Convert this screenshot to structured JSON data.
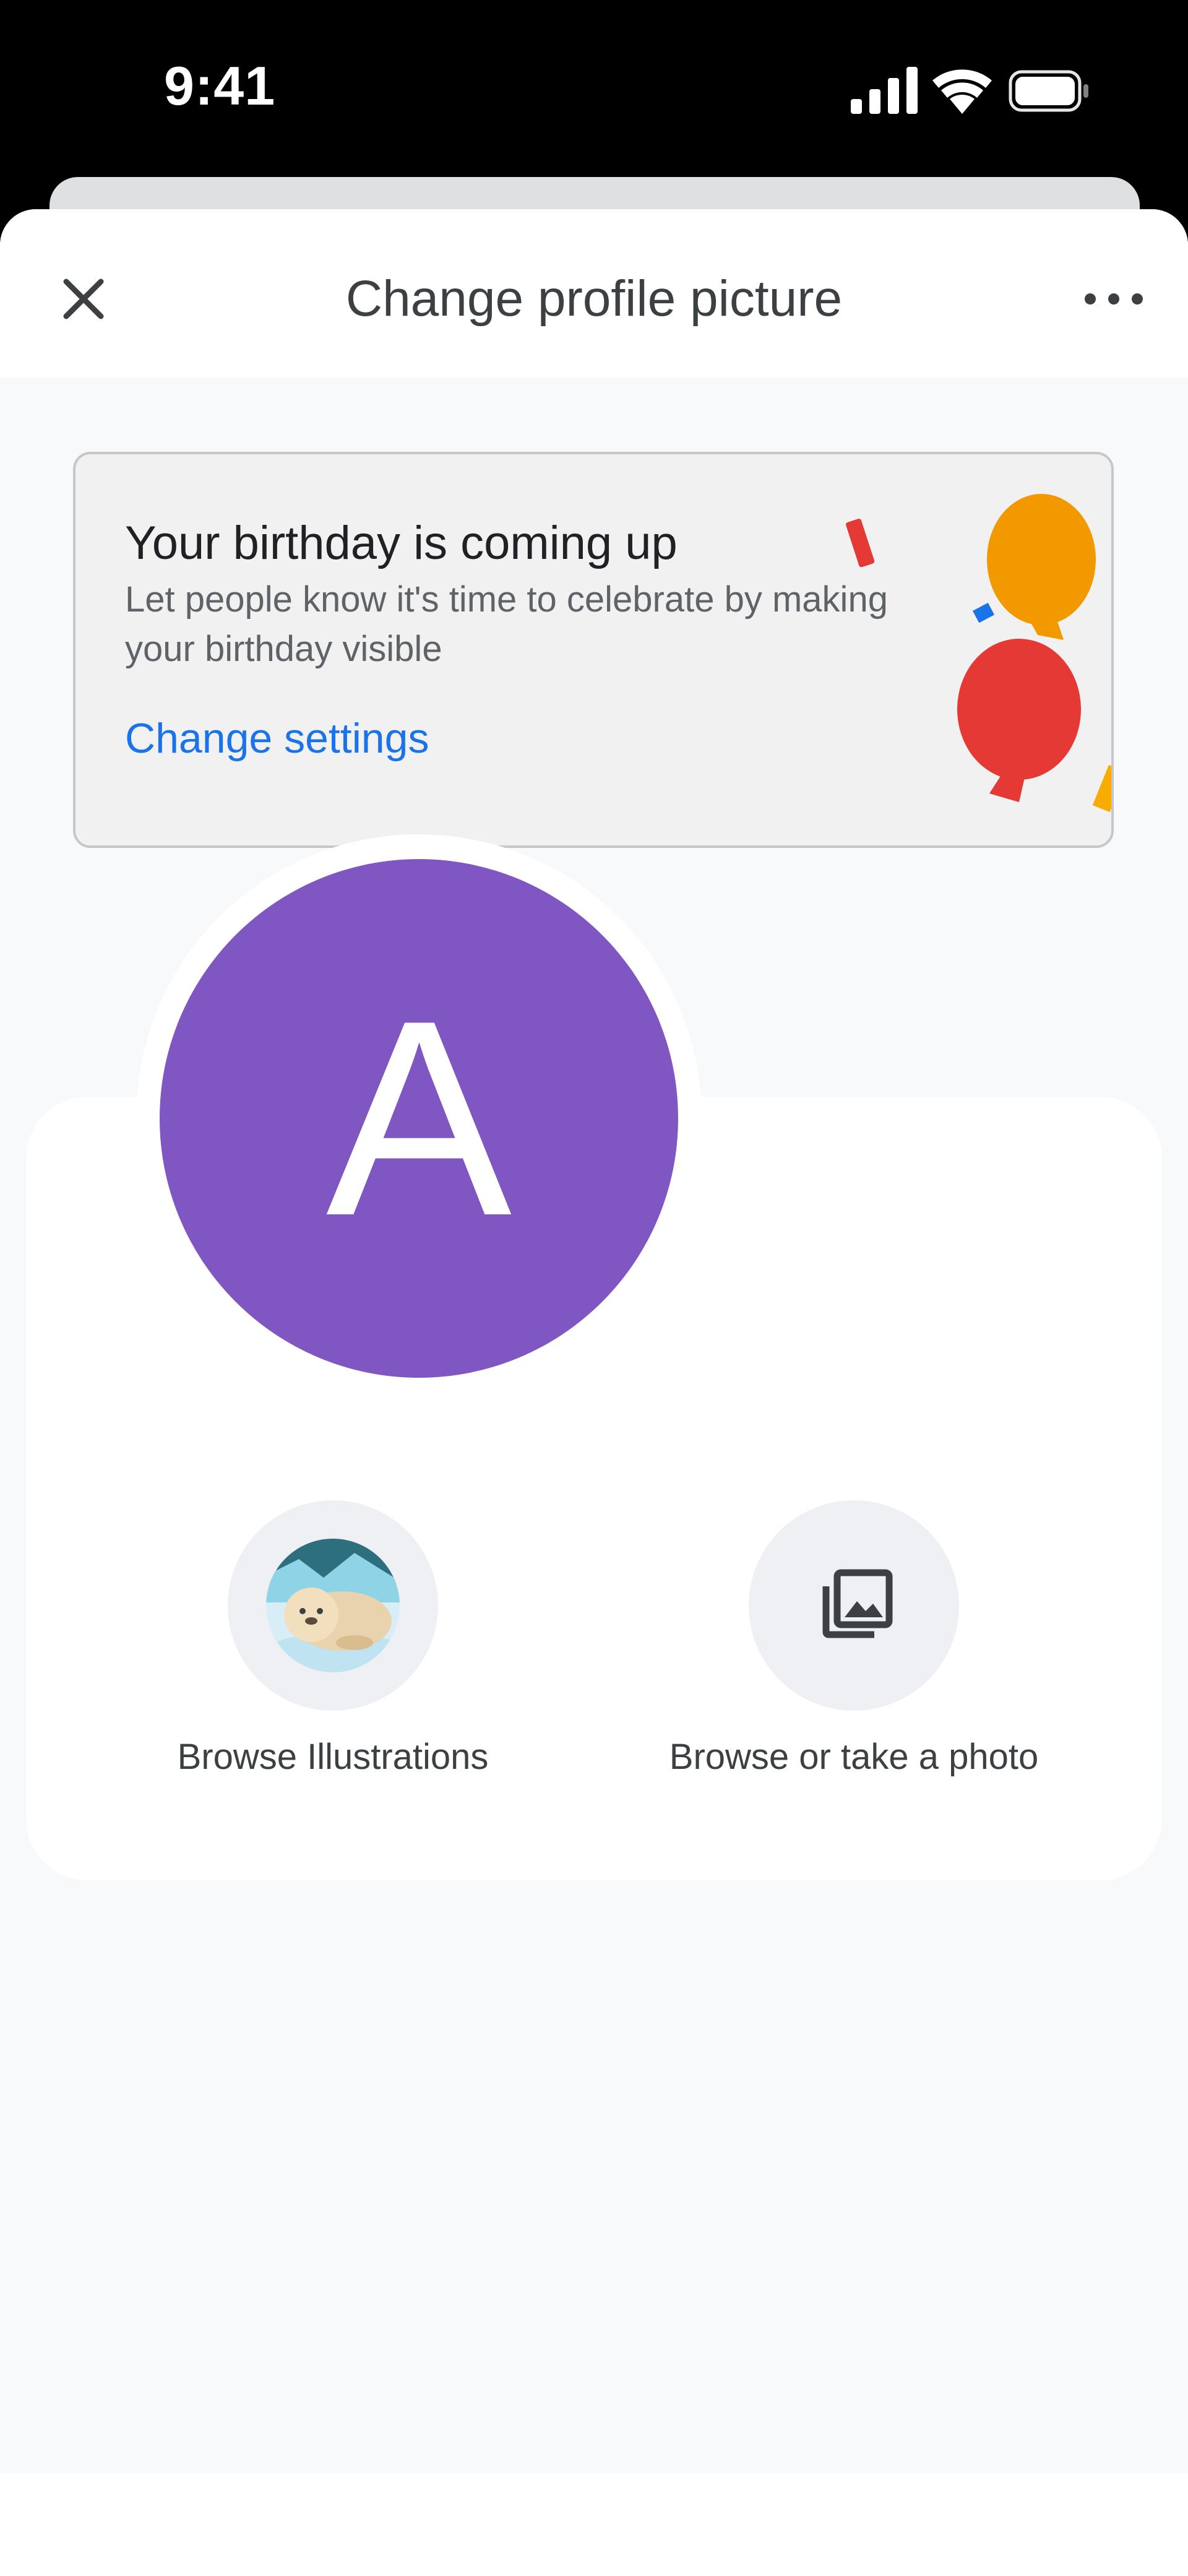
{
  "status_bar": {
    "time": "9:41",
    "icons": [
      "signal-icon",
      "wifi-icon",
      "battery-icon"
    ]
  },
  "header": {
    "title": "Change profile picture",
    "close_icon": "close-icon",
    "more_icon": "more-horizontal-icon"
  },
  "birthday_card": {
    "title": "Your birthday is coming up",
    "body": "Let people know it's time to celebrate by making your birthday visible",
    "link": "Change settings",
    "illustration": "balloons-illustration"
  },
  "avatar": {
    "letter": "A",
    "color": "#7f56c2"
  },
  "options": [
    {
      "label": "Browse Illustrations",
      "icon": "seal-illustration-icon"
    },
    {
      "label": "Browse or take a photo",
      "icon": "photo-library-icon"
    }
  ],
  "colors": {
    "accent": "#1a73e8",
    "sheet_background": "#f8f9fb",
    "card_background": "#f1f1f1"
  }
}
